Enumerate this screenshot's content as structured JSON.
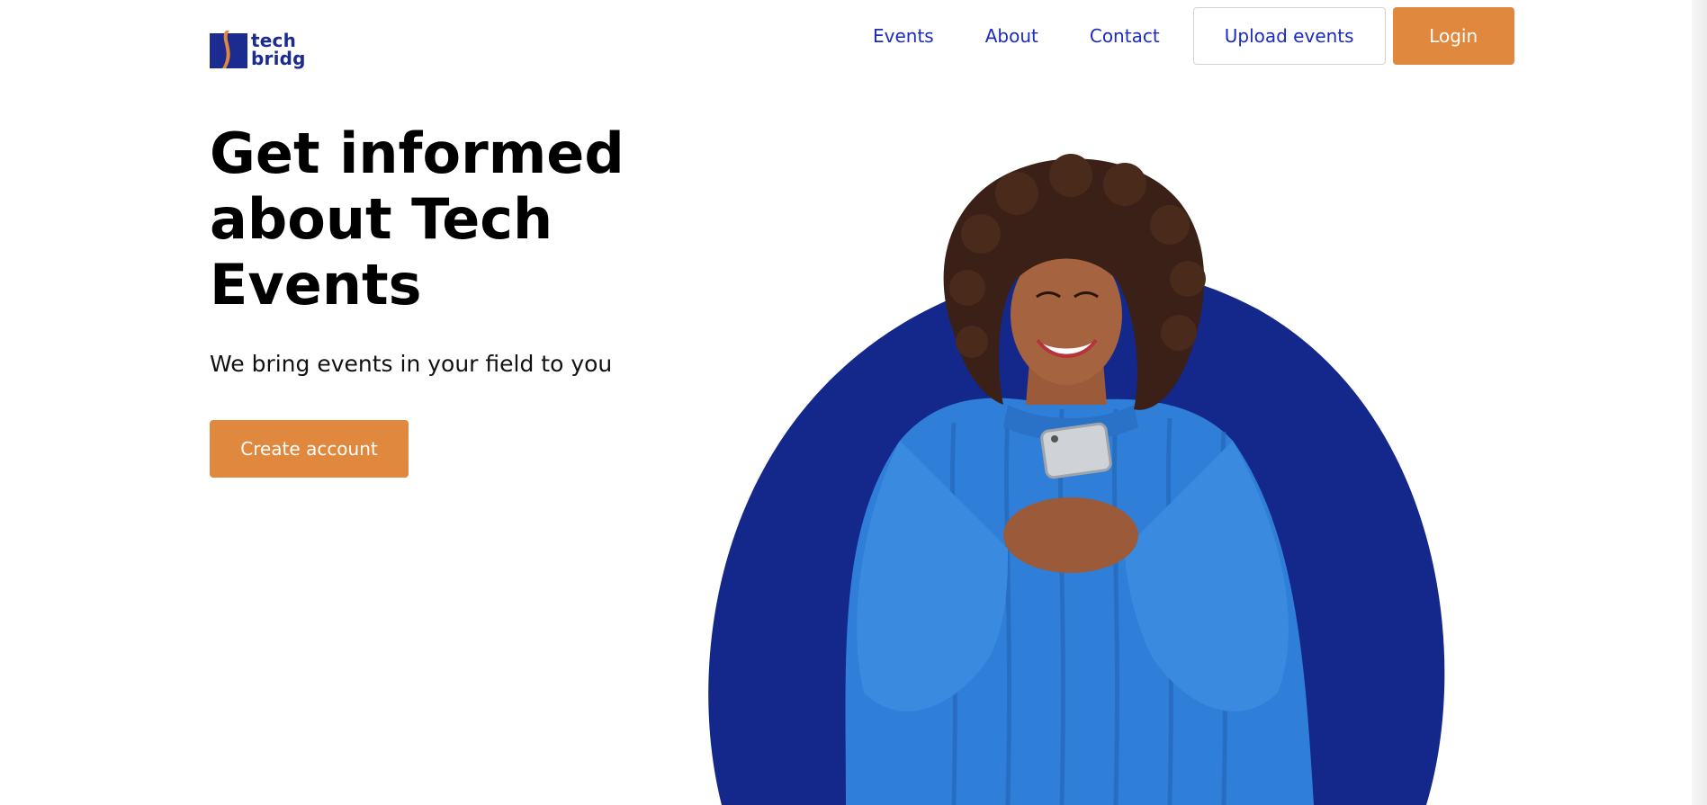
{
  "header": {
    "logo": {
      "line1": "tech",
      "line2": "bridg"
    },
    "nav": {
      "events_label": "Events",
      "about_label": "About",
      "contact_label": "Contact"
    },
    "upload_label": "Upload events",
    "login_label": "Login"
  },
  "hero": {
    "title_lines": [
      "Get informed",
      "about Tech",
      "Events"
    ],
    "subtitle": "We bring events in your field to you",
    "cta_label": "Create account",
    "image_icon": "woman-using-phone-illustration"
  },
  "colors": {
    "accent": "#e0883d",
    "brand_blue": "#1b2b8f",
    "link_blue": "#1b2bbd",
    "circle_blue": "#13288a",
    "sweater_blue": "#2f7fd8"
  }
}
